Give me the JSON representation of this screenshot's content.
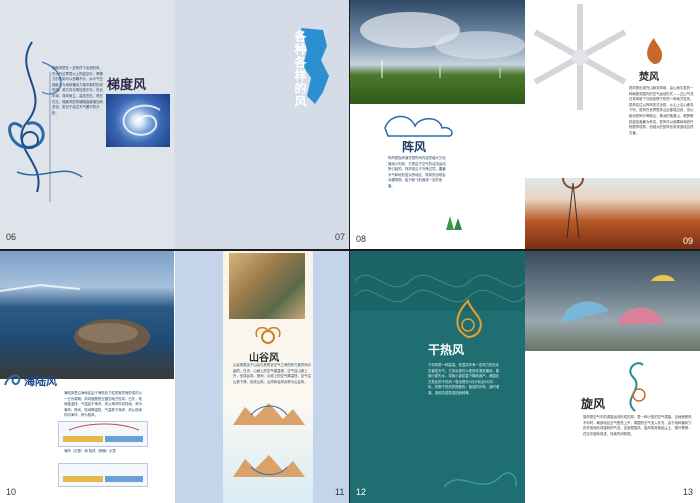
{
  "spreads": [
    {
      "left": {
        "page_number": "06",
        "title": "梯度风",
        "body": "梯度风是在一定条件下出现的风，在大气边界层以上的高空中，摩擦力的作用可以忽略不计，水平气压梯度力与地转偏向力相平衡时形成的风，其方向与等压线平行。在北半球，背风而立，高压在右，低压在左。梯度风的风速随高度增加而变化，常见于高空天气图中的分析。"
      },
      "right": {
        "page_number": "07",
        "vertical_title": "各种各样的风"
      }
    },
    {
      "left": {
        "page_number": "08",
        "title": "阵风",
        "body": "阵风是指风速在短时间内突然增大又迅速减小的风，它是由于空气的湍流运动所引起的。阵风常见于冷锋过境、雷暴天气和地形复杂的地区，阵风的出现会对建筑物、船只和飞机造成一定的危害。"
      },
      "right": {
        "page_number": "09",
        "title": "焚风",
        "body": "焚风是出现在山脉背风坡，由山地引发的一种局部范围内的空气运动形式——过山气流在背风坡下沉而变得干热的一种地方性风。焚风往往以阵风形式出现，从山上沿山坡向下吹。焚风在世界很多山区都能见到，但以欧洲的阿尔卑斯山、美洲的落基山、俄罗斯的高加索最为有名。焚风可以使果树和农作物提早成熟，但强大的焚风也常常造成自然灾害。"
      }
    },
    {
      "left": {
        "page_number": "10",
        "title": "海陆风",
        "body": "海陆风是沿海地区由于海陆热力性质差异而形成的以一日为周期、风向随昼夜交替的地方性风。白天，陆地增温快，气温高于海洋，风从海洋吹向陆地，称为海风；夜间，陆地降温快，气温低于海洋，风从陆地吹向海洋，称为陆风。",
        "caption": "海风（白昼）和 陆风（夜晚）示意"
      },
      "right": {
        "page_number": "11",
        "title": "山谷风",
        "body": "山谷风是由于山谷与其附近空气之间的热力差异而引起的。白天，山坡上的空气增温快，空气沿山坡上升，形成谷风；夜间，山坡上的空气降温快，空气沿山坡下滑，形成山风。山风和谷风合称为山谷风。"
      }
    },
    {
      "left": {
        "page_number": "12",
        "title": "干热风",
        "body": "干热风是一种高温、低湿并伴有一定风力的农业灾害性天气，它多出现在小麦扬花灌浆期间，能使小麦失水，导致小麦粒重下降而减产。我国北方麦区的干热风一般出现在5月中旬至6月中旬，防御干热风的措施有：营造防护林、适时灌溉、选用抗逆性强的品种等。"
      },
      "right": {
        "page_number": "13",
        "title": "旋风",
        "body": "旋风是空气中的涡旋运动形成的风，是一种小型的空气涡旋。当地面受热不均时，局部地区空气受热上升，周围的空气流入补充，由于地转偏向力的作用而形成旋转的气流，这就是旋风。旋风常常卷起尘土、落叶等物，在空中旋转前进，持续时间较短。"
      }
    }
  ]
}
